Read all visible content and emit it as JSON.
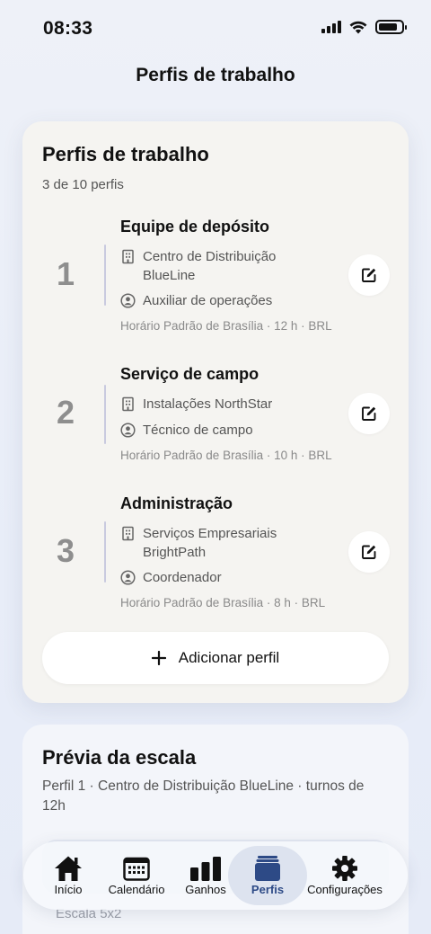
{
  "status": {
    "time": "08:33"
  },
  "nav": {
    "title": "Perfis de trabalho"
  },
  "card": {
    "title": "Perfis de trabalho",
    "subtitle": "3 de 10 perfis",
    "profiles": [
      {
        "number": "1",
        "name": "Equipe de depósito",
        "company_line1": "Centro de Distribuição",
        "company_line2": "BlueLine",
        "role": "Auxiliar de operações",
        "meta": "Horário Padrão de Brasília · 12 h · BRL"
      },
      {
        "number": "2",
        "name": "Serviço de campo",
        "company_line1": "Instalações NorthStar",
        "company_line2": "",
        "role": "Técnico de campo",
        "meta": "Horário Padrão de Brasília · 10 h · BRL"
      },
      {
        "number": "3",
        "name": "Administração",
        "company_line1": "Serviços Empresariais",
        "company_line2": "BrightPath",
        "role": "Coordenador",
        "meta": "Horário Padrão de Brasília · 8 h · BRL"
      }
    ],
    "add_label": "Adicionar perfil"
  },
  "preview": {
    "title": "Prévia da escala",
    "description": "Perfil 1 · Centro de Distribuição BlueLine · turnos de 12h",
    "footer": "Escala 5x2"
  },
  "tabs": [
    {
      "label": "Início",
      "icon": "home-icon"
    },
    {
      "label": "Calendário",
      "icon": "calendar-icon"
    },
    {
      "label": "Ganhos",
      "icon": "bar-chart-icon"
    },
    {
      "label": "Perfis",
      "icon": "profiles-icon",
      "active": true
    },
    {
      "label": "Configurações",
      "icon": "gear-icon"
    }
  ],
  "colors": {
    "accent": "#2d4a86",
    "active_tab_bg": "#dde3ef"
  }
}
